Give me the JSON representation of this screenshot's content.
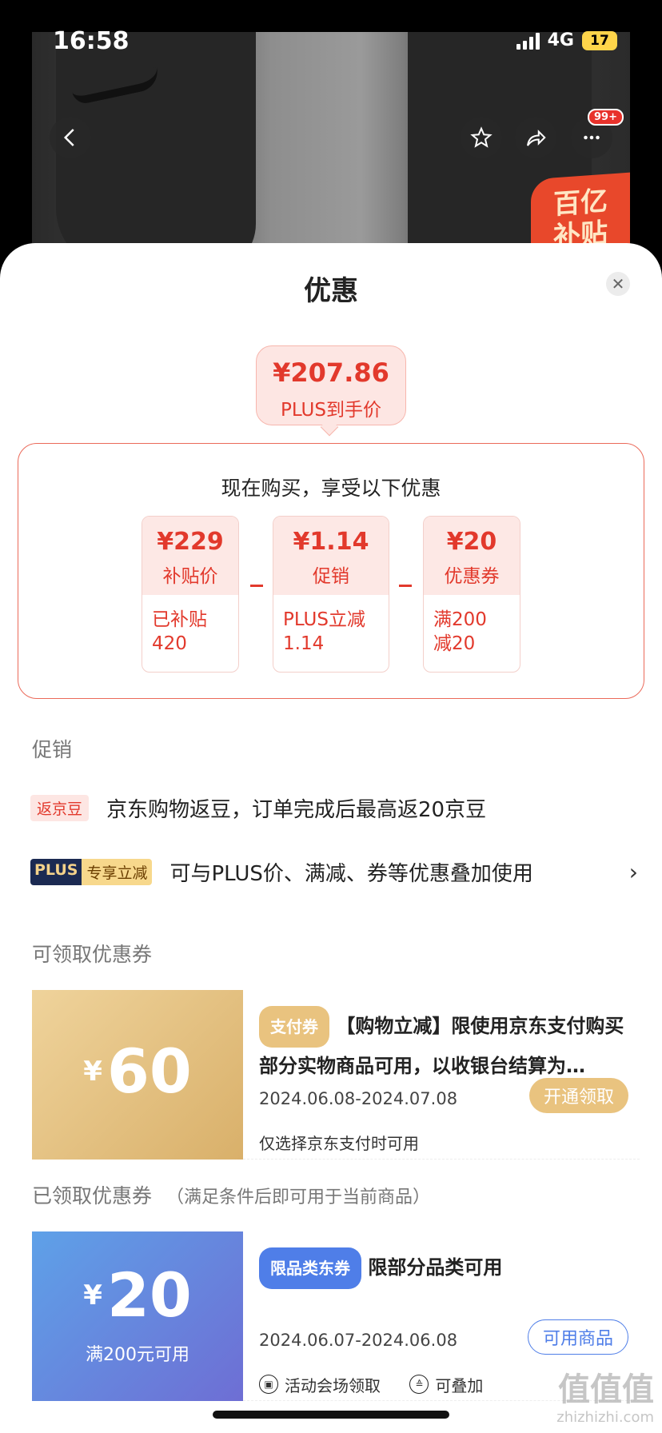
{
  "status_bar": {
    "time": "16:58",
    "network": "4G",
    "battery": "17"
  },
  "top_nav": {
    "badge": "99+",
    "promo_tag": "百亿 补贴"
  },
  "sheet": {
    "title": "优惠",
    "price": {
      "value": "¥207.86",
      "label": "PLUS到手价"
    },
    "breakdown": {
      "title": "现在购买，享受以下优惠",
      "cards": [
        {
          "value": "¥229",
          "label": "补贴价",
          "detail_1": "已补贴",
          "detail_2": "420"
        },
        {
          "value": "¥1.14",
          "label": "促销",
          "detail_1": "PLUS立减",
          "detail_2": "1.14"
        },
        {
          "value": "¥20",
          "label": "优惠券",
          "detail_1": "满200",
          "detail_2": "减20"
        }
      ]
    },
    "promotion": {
      "section_label": "促销",
      "rows": [
        {
          "tag": "返京豆",
          "text": "京东购物返豆，订单完成后最高返20京豆"
        },
        {
          "tag_a": "PLUS",
          "tag_b": "专享立减",
          "text": "可与PLUS价、满减、券等优惠叠加使用"
        }
      ]
    },
    "available_coupons": {
      "section_label": "可领取优惠券",
      "coupon": {
        "currency": "¥",
        "amount": "60",
        "tag": "支付券",
        "title": "【购物立减】限使用京东支付购买部分实物商品可用，以收银台结算为…",
        "date": "2024.06.08-2024.07.08",
        "note": "仅选择京东支付时可用",
        "button": "开通领取"
      }
    },
    "claimed_coupons": {
      "section_label": "已领取优惠券",
      "section_hint": "（满足条件后即可用于当前商品）",
      "coupon": {
        "currency": "¥",
        "amount": "20",
        "condition": "满200元可用",
        "tag": "限品类东券",
        "title": "限部分品类可用",
        "date": "2024.06.07-2024.06.08",
        "button": "可用商品",
        "feature_1": "活动会场领取",
        "feature_2": "可叠加"
      }
    }
  },
  "watermark": {
    "text": "值值值",
    "site": "zhizhizhi.com"
  }
}
